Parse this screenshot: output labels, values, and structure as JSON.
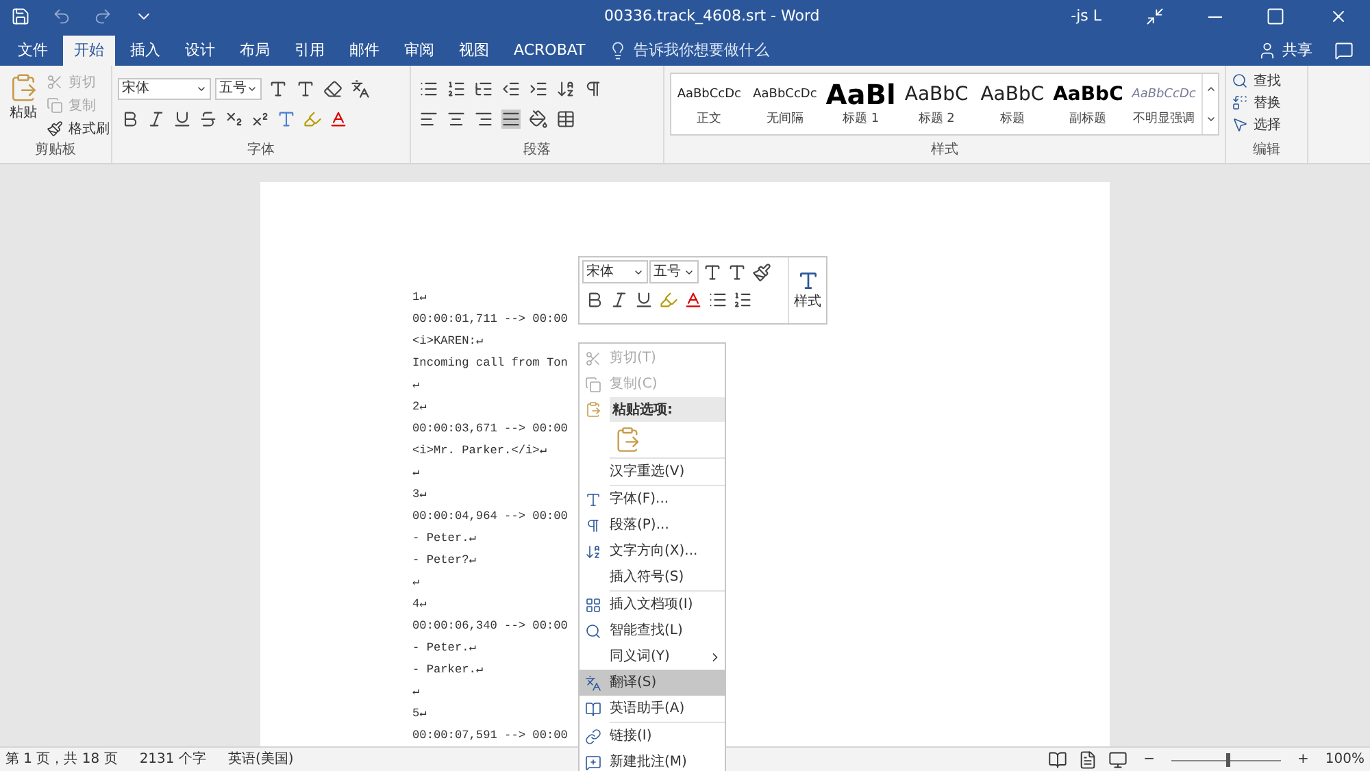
{
  "window": {
    "title": "00336.track_4608.srt  -  Word",
    "user": "-js L"
  },
  "tabs": [
    {
      "label": "文件",
      "selected": false
    },
    {
      "label": "开始",
      "selected": true
    },
    {
      "label": "插入",
      "selected": false
    },
    {
      "label": "设计",
      "selected": false
    },
    {
      "label": "布局",
      "selected": false
    },
    {
      "label": "引用",
      "selected": false
    },
    {
      "label": "邮件",
      "selected": false
    },
    {
      "label": "审阅",
      "selected": false
    },
    {
      "label": "视图",
      "selected": false
    },
    {
      "label": "ACROBAT",
      "selected": false
    }
  ],
  "tell_me": {
    "placeholder": "告诉我你想要做什么"
  },
  "share": "共享",
  "clipboard": {
    "paste": "粘贴",
    "items": [
      {
        "label": "剪切",
        "disabled": true
      },
      {
        "label": "复制",
        "disabled": true
      },
      {
        "label": "格式刷",
        "disabled": false
      }
    ],
    "group": "剪贴板"
  },
  "font": {
    "family": "宋体",
    "size": "五号",
    "group": "字体"
  },
  "paragraph": {
    "group": "段落"
  },
  "styles": {
    "group": "样式",
    "items": [
      {
        "preview": "AaBbCcDc",
        "label": "正文",
        "kind": "normal"
      },
      {
        "preview": "AaBbCcDc",
        "label": "无间隔",
        "kind": "normal"
      },
      {
        "preview": "AaBl",
        "label": "标题 1",
        "kind": "heading1"
      },
      {
        "preview": "AaBbC",
        "label": "标题 2",
        "kind": "heading2"
      },
      {
        "preview": "AaBbC",
        "label": "标题",
        "kind": "heading2"
      },
      {
        "preview": "AaBbC",
        "label": "副标题",
        "kind": "bold"
      },
      {
        "preview": "AaBbCcDc",
        "label": "不明显强调",
        "kind": "italic"
      }
    ]
  },
  "editing": {
    "group": "编辑",
    "items": [
      "查找",
      "替换",
      "选择"
    ]
  },
  "document": {
    "lines": [
      "1↵",
      "00:00:01,711 --> 00:00",
      "<i>KAREN:↵",
      "Incoming call from Ton",
      "↵",
      "2↵",
      "00:00:03,671 --> 00:00",
      "<i>Mr. Parker.</i>↵",
      "↵",
      "3↵",
      "00:00:04,964 --> 00:00",
      "- Peter.↵",
      "- Peter?↵",
      "↵",
      "4↵",
      "00:00:06,340 --> 00:00",
      "- Peter.↵",
      "- Parker.↵",
      "↵",
      "5↵",
      "00:00:07,591 --> 00:00"
    ]
  },
  "mini_toolbar": {
    "family": "宋体",
    "size": "五号",
    "styles": "样式"
  },
  "context_menu": [
    {
      "kind": "item",
      "label": "剪切(T)",
      "disabled": true,
      "selected": false,
      "submenu": false
    },
    {
      "kind": "item",
      "label": "复制(C)",
      "disabled": true,
      "selected": false,
      "submenu": false
    },
    {
      "kind": "header",
      "label": "粘贴选项:"
    },
    {
      "kind": "paste"
    },
    {
      "kind": "separator"
    },
    {
      "kind": "item",
      "label": "汉字重选(V)",
      "disabled": false,
      "selected": false,
      "submenu": false
    },
    {
      "kind": "separator"
    },
    {
      "kind": "item",
      "label": "字体(F)...",
      "disabled": false,
      "selected": false,
      "submenu": false
    },
    {
      "kind": "item",
      "label": "段落(P)...",
      "disabled": false,
      "selected": false,
      "submenu": false
    },
    {
      "kind": "item",
      "label": "文字方向(X)...",
      "disabled": false,
      "selected": false,
      "submenu": false
    },
    {
      "kind": "item",
      "label": "插入符号(S)",
      "disabled": false,
      "selected": false,
      "submenu": false
    },
    {
      "kind": "separator"
    },
    {
      "kind": "item",
      "label": "插入文档项(I)",
      "disabled": false,
      "selected": false,
      "submenu": false
    },
    {
      "kind": "item",
      "label": "智能查找(L)",
      "disabled": false,
      "selected": false,
      "submenu": false
    },
    {
      "kind": "item",
      "label": "同义词(Y)",
      "disabled": false,
      "selected": false,
      "submenu": true
    },
    {
      "kind": "item",
      "label": "翻译(S)",
      "disabled": false,
      "selected": true,
      "submenu": false
    },
    {
      "kind": "item",
      "label": "英语助手(A)",
      "disabled": false,
      "selected": false,
      "submenu": false
    },
    {
      "kind": "separator"
    },
    {
      "kind": "item",
      "label": "链接(I)",
      "disabled": false,
      "selected": false,
      "submenu": false
    },
    {
      "kind": "item",
      "label": "新建批注(M)",
      "disabled": false,
      "selected": false,
      "submenu": false
    }
  ],
  "status_bar": {
    "page": "第 1 页，共 18 页",
    "words": "2131 个字",
    "language": "英语(美国)",
    "zoom_out": "−",
    "zoom_in": "+",
    "zoom": "100%",
    "level": 0.5
  }
}
